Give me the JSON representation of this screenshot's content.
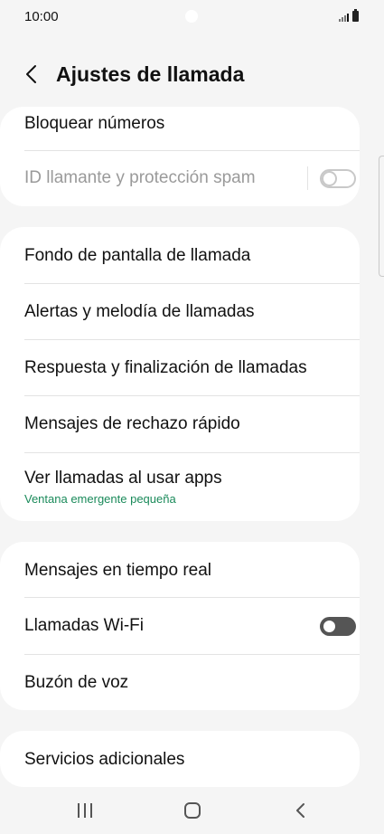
{
  "status": {
    "time": "10:00"
  },
  "header": {
    "title": "Ajustes de llamada"
  },
  "section1": {
    "items": [
      {
        "label": "Bloquear números"
      },
      {
        "label": "ID llamante y protección spam",
        "toggle": "off",
        "enabled": false
      }
    ]
  },
  "section2": {
    "items": [
      {
        "label": "Fondo de pantalla de llamada"
      },
      {
        "label": "Alertas y melodía de llamadas"
      },
      {
        "label": "Respuesta y finalización de llamadas"
      },
      {
        "label": "Mensajes de rechazo rápido"
      },
      {
        "label": "Ver llamadas al usar apps",
        "sublabel": "Ventana emergente pequeña"
      }
    ]
  },
  "section3": {
    "items": [
      {
        "label": "Mensajes en tiempo real"
      },
      {
        "label": "Llamadas Wi-Fi",
        "toggle": "off"
      },
      {
        "label": "Buzón de voz"
      }
    ]
  },
  "section4": {
    "items": [
      {
        "label": "Servicios adicionales"
      }
    ]
  },
  "colors": {
    "accent": "#1a8a5a",
    "card": "#ffffff",
    "background": "#f5f5f5"
  },
  "nav": {
    "icons": [
      "recent-apps-icon",
      "home-icon",
      "back-icon"
    ]
  }
}
